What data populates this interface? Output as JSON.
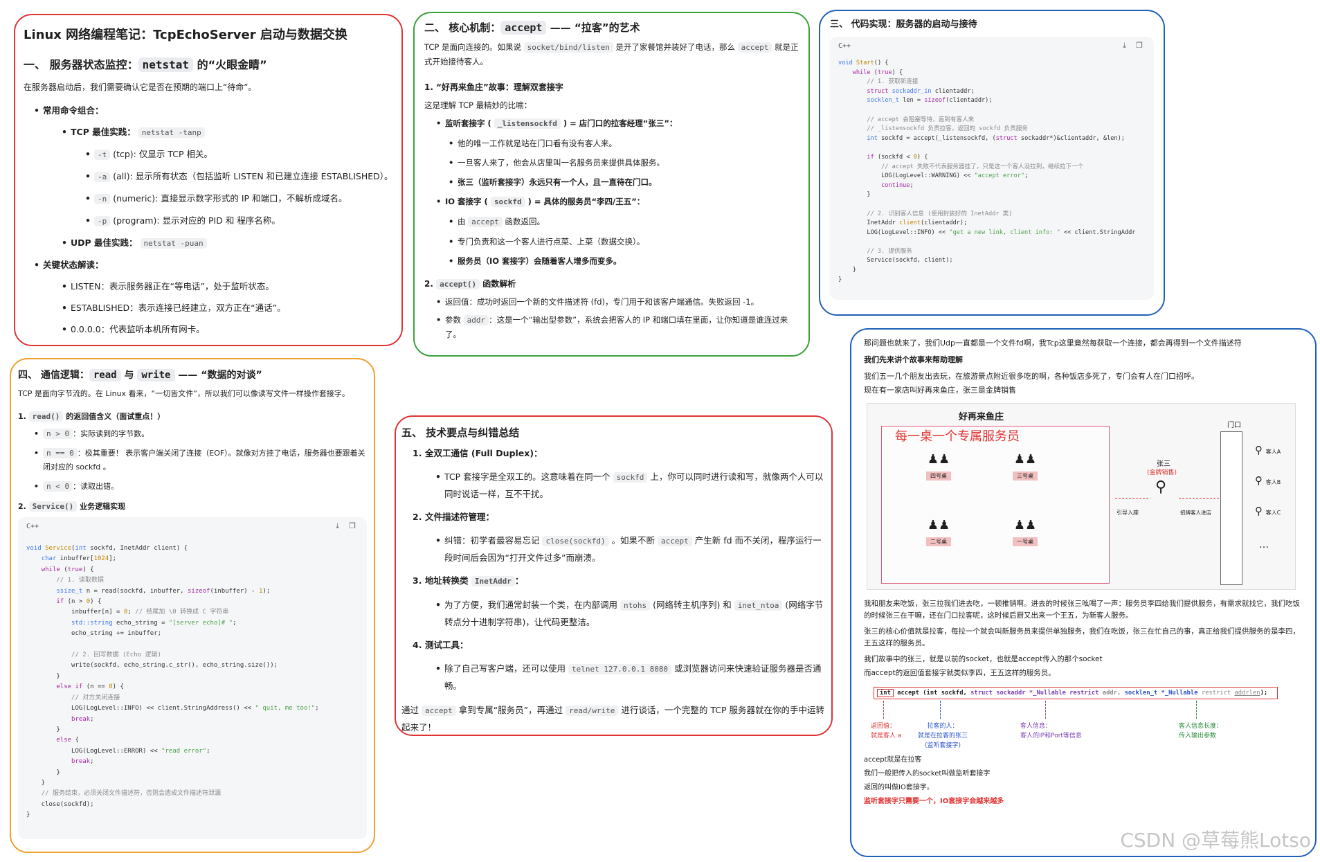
{
  "p1": {
    "title": "Linux 网络编程笔记：TcpEchoServer 启动与数据交换",
    "h_a": "一、 服务器状态监控：",
    "h_code": "netstat",
    "h_b": " 的“火眼金睛”",
    "intro": "在服务器启动后，我们需要确认它是否在预期的端口上“待命”。",
    "common": "常用命令组合：",
    "tcp_label": "TCP 最佳实践：",
    "tcp_cmd": "netstat -tanp",
    "opts": [
      {
        "flag": "-t",
        "text": " (tcp): 仅显示 TCP 相关。"
      },
      {
        "flag": "-a",
        "text": " (all): 显示所有状态（包括监听 LISTEN 和已建立连接 ESTABLISHED）。"
      },
      {
        "flag": "-n",
        "text": " (numeric): 直接显示数字形式的 IP 和端口，不解析成域名。"
      },
      {
        "flag": "-p",
        "text": " (program): 显示对应的 PID 和 程序名称。"
      }
    ],
    "udp_label": "UDP 最佳实践：",
    "udp_cmd": "netstat -puan",
    "key": "关键状态解读：",
    "states": [
      "LISTEN：表示服务器正在“等电话”，处于监听状态。",
      "ESTABLISHED：表示连接已经建立，双方正在“通话”。",
      "0.0.0.0：代表监听本机所有网卡。"
    ]
  },
  "p2": {
    "h_a": "二、 核心机制：",
    "h_code": "accept",
    "h_b": " —— “拉客”的艺术",
    "intro_a": "TCP 是面向连接的。如果说 ",
    "intro_code": "socket/bind/listen",
    "intro_b": " 是开了家餐馆并装好了电话，那么 ",
    "intro_code2": "accept",
    "intro_c": " 就是正式开始接待客人。",
    "s1": "1. “好再来鱼庄”故事：理解双套接字",
    "s1_intro": "这是理解 TCP 最精妙的比喻：",
    "listen_a": "监听套接字 ( ",
    "listen_code": "_listensockfd",
    "listen_b": " ) = 店门口的拉客经理“张三”：",
    "listen_items": [
      "他的唯一工作就是站在门口看有没有客人来。",
      "一旦客人来了，他会从店里叫一名服务员来提供具体服务。",
      "张三（监听套接字）永远只有一个人，且一直待在门口。"
    ],
    "io_a": "IO 套接字 ( ",
    "io_code": "sockfd",
    "io_b": " ) = 具体的服务员“李四/王五”：",
    "io_items": [
      {
        "pre": "由 ",
        "code": "accept",
        "post": " 函数返回。"
      },
      {
        "pre": "专门负责和这一个客人进行点菜、上菜（数据交换）。",
        "code": "",
        "post": ""
      },
      {
        "pre": "服务员（IO 套接字）会随着客人增多而变多。",
        "code": "",
        "post": ""
      }
    ],
    "s2_a": "2. ",
    "s2_code": "accept()",
    "s2_b": " 函数解析",
    "ret": "返回值：成功时返回一个新的文件描述符 (fd)，专门用于和该客户端通信。失败返回 -1。",
    "param_a": "参数 ",
    "param_code": "addr",
    "param_b": "：这是一个“输出型参数”，系统会把客人的 IP 和端口填在里面，让你知道是谁连过来了。"
  },
  "p3": {
    "title": "三、 代码实现：服务器的启动与接待",
    "lang": "C++"
  },
  "p4": {
    "h_a": "四、 通信逻辑：",
    "h_c1": "read",
    "h_mid": " 与 ",
    "h_c2": "write",
    "h_b": " —— “数据的对谈”",
    "intro": "TCP 是面向字节流的。在 Linux 看来，“一切皆文件”，所以我们可以像读写文件一样操作套接字。",
    "s1_a": "1. ",
    "s1_code": "read()",
    "s1_b": " 的返回值含义（面试重点！）",
    "items": [
      {
        "code": "n > 0",
        "text": "：实际读到的字节数。"
      },
      {
        "code": "n == 0",
        "text": "：极其重要！ 表示客户端关闭了连接（EOF）。就像对方挂了电话，服务器也要跟着关闭对应的 sockfd 。"
      },
      {
        "code": "n < 0",
        "text": "：读取出错。"
      }
    ],
    "s2_a": "2. ",
    "s2_code": "Service()",
    "s2_b": " 业务逻辑实现",
    "lang": "C++"
  },
  "p5": {
    "title": "五、 技术要点与纠错总结",
    "n1": "全双工通信 (Full Duplex)：",
    "n1_a": "TCP 套接字是全双工的。这意味着在同一个 ",
    "n1_code": "sockfd",
    "n1_b": " 上，你可以同时进行读和写，就像两个人可以同时说话一样，互不干扰。",
    "n2": "文件描述符管理：",
    "n2_a": "纠错：初学者最容易忘记 ",
    "n2_code": "close(sockfd)",
    "n2_b": " 。如果不断 ",
    "n2_code2": "accept",
    "n2_c": " 产生新 fd 而不关闭，程序运行一段时间后会因为“打开文件过多”而崩溃。",
    "n3_a": "地址转换类 ",
    "n3_code": "InetAddr",
    "n3_b": "：",
    "n3_x": "为了方便，我们通常封装一个类，在内部调用 ",
    "n3_c1": "ntohs",
    "n3_y": " (网络转主机序列) 和 ",
    "n3_c2": "inet_ntoa",
    "n3_z": " (网络字节转点分十进制字符串)，让代码更整洁。",
    "n4": "测试工具：",
    "n4_a": "除了自己写客户端，还可以使用 ",
    "n4_code": "telnet 127.0.0.1 8080",
    "n4_b": " 或浏览器访问来快速验证服务器是否通畅。",
    "out_a": "通过 ",
    "out_c1": "accept",
    "out_b": " 拿到专属“服务员”，再通过 ",
    "out_c2": "read/write",
    "out_c": " 进行谈话，一个完整的 TCP 服务器就在你的手中运转起来了！"
  },
  "p6": {
    "q": "那问题也就来了，我们Udp一直都是一个文件fd啊，我Tcp这里竟然每获取一个连接，都会再得到一个文件描述符",
    "story_h": "我们先来讲个故事来帮助理解",
    "s1": "我们五一几个朋友出去玩，在旅游景点附近很多吃的啊，各种饭店多死了，专门会有人在门口招呼。",
    "s2": "现在有一家店叫好再来鱼庄，张三是金牌销售",
    "d_title": "好再来鱼庄",
    "d_red": "每一桌一个专属服务员",
    "d_door": "门口",
    "tables": [
      "四号桌",
      "三号桌",
      "二号桌",
      "一号桌"
    ],
    "zs": "张三",
    "zs_sub": "(金牌销售)",
    "lead": "引导入座",
    "invite": "招牌客人进店",
    "guests": [
      "客人A",
      "客人B",
      "客人C"
    ],
    "dots": "…",
    "b1": "我和朋友来吃饭，张三拉我们进去吃，一顿推销啊。进去的时候张三吆喝了一声：服务员李四给我们提供服务，有需求就找它，我们吃饭的时候张三在干嘛，还在门口拉客呢，这时候后厨又出来一个王五，为新客人服务。",
    "b2": "张三的核心价值就是拉客，每拉一个就会叫新服务员来提供单独服务，我们在吃饭，张三在忙自己的事，真正给我们提供服务的是李四，王五这样的服务员。",
    "b3": "我们故事中的张三，就是以前的socket，也就是accept传入的那个socket",
    "b4": "而accept的返回值套接字就类似李四，王五这样的服务员。",
    "sig": {
      "int": "int",
      "acc": "accept",
      "p1": "(int sockfd, ",
      "p2": "struct sockaddr *_Nullable restrict ",
      "p3": "addr, ",
      "p4": "socklen_t *_Nullable ",
      "p5": "restrict ",
      "p6": "addrlen",
      "p7": ");"
    },
    "ann": [
      {
        "a": "返回值：",
        "b": "就是客人 a"
      },
      {
        "a": "拉客的人：",
        "b": "就是在拉客的张三",
        "c": "(监听套接字)"
      },
      {
        "a": "客人信息：",
        "b": "客人的IP和Port等信息"
      },
      {
        "a": "客人信息长度：",
        "b": "传入输出参数"
      }
    ],
    "f1": "accept就是在拉客",
    "f2": "我们一般把传入的socket叫做监听套接字",
    "f3": "返回的叫做IO套接字。",
    "f4": "监听套接字只需要一个，IO套接字会越来越多",
    "wm": "CSDN @草莓熊Lotso"
  },
  "colors": {
    "red": "#e03333",
    "green": "#3aa03a",
    "blue": "#2060b8",
    "orange": "#f0a030"
  }
}
